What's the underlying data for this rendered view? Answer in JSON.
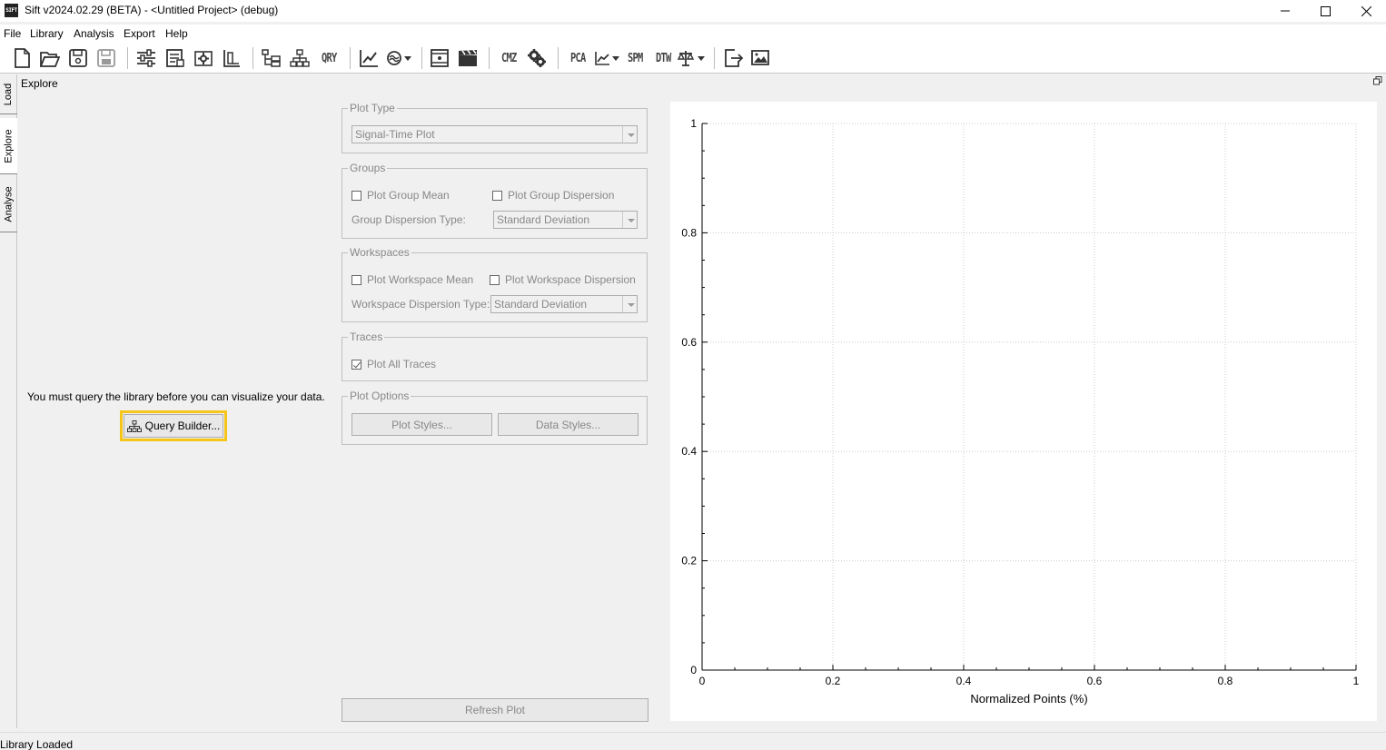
{
  "window": {
    "app_icon_text": "SIFT",
    "title": "Sift v2024.02.29 (BETA) - <Untitled Project> (debug)"
  },
  "menu": [
    "File",
    "Library",
    "Analysis",
    "Export",
    "Help"
  ],
  "toolbar": {
    "text_buttons": [
      "QRY",
      "CMZ",
      "PCA",
      "SPM",
      "DTW"
    ]
  },
  "side_tabs": [
    "Load",
    "Explore",
    "Analyse"
  ],
  "panel": {
    "title": "Explore",
    "query_message": "You must query the library before you can visualize your data.",
    "query_button": "Query Builder..."
  },
  "plot_type": {
    "title": "Plot Type",
    "value": "Signal-Time Plot"
  },
  "groups": {
    "title": "Groups",
    "plot_mean": "Plot Group Mean",
    "plot_dispersion": "Plot Group Dispersion",
    "dispersion_label": "Group Dispersion Type:",
    "dispersion_value": "Standard Deviation"
  },
  "workspaces": {
    "title": "Workspaces",
    "plot_mean": "Plot Workspace Mean",
    "plot_dispersion": "Plot Workspace Dispersion",
    "dispersion_label": "Workspace Dispersion Type:",
    "dispersion_value": "Standard Deviation"
  },
  "traces": {
    "title": "Traces",
    "plot_all": "Plot All Traces",
    "plot_all_checked": true
  },
  "plot_options": {
    "title": "Plot Options",
    "plot_styles": "Plot Styles...",
    "data_styles": "Data Styles..."
  },
  "refresh_button": "Refresh Plot",
  "status": "Library Loaded",
  "chart_data": {
    "type": "line",
    "x_ticks": [
      "0",
      "0.2",
      "0.4",
      "0.6",
      "0.8",
      "1"
    ],
    "y_ticks": [
      "0",
      "0.2",
      "0.4",
      "0.6",
      "0.8",
      "1"
    ],
    "xlabel": "Normalized Points (%)",
    "ylabel": "",
    "xlim": [
      0,
      1
    ],
    "ylim": [
      0,
      1
    ],
    "grid": true,
    "series": []
  }
}
